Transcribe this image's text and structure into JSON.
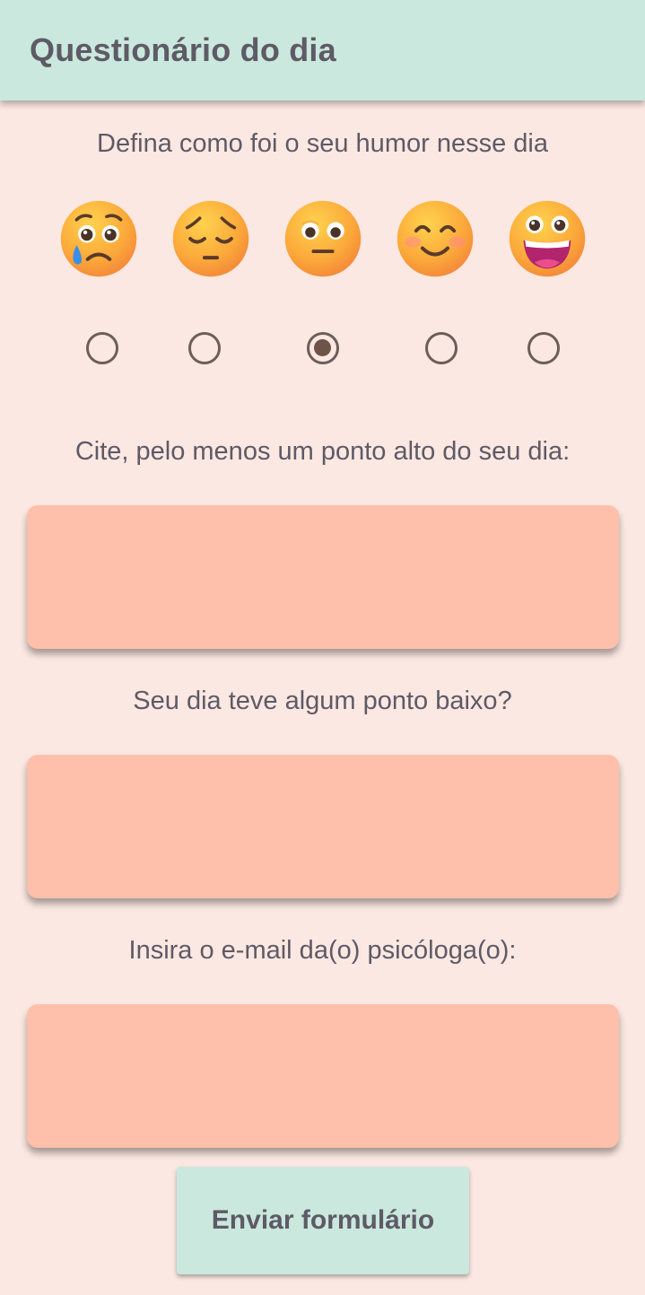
{
  "appbar": {
    "title": "Questionário do dia"
  },
  "mood": {
    "question": "Defina como foi o seu humor nesse dia",
    "options": [
      {
        "icon": "sad-tear-face-icon",
        "selected": false
      },
      {
        "icon": "pensive-face-icon",
        "selected": false
      },
      {
        "icon": "neutral-face-icon",
        "selected": true
      },
      {
        "icon": "smiling-blush-face-icon",
        "selected": false
      },
      {
        "icon": "grinning-face-icon",
        "selected": false
      }
    ]
  },
  "high_point": {
    "label": "Cite, pelo menos um ponto alto do seu dia:",
    "value": ""
  },
  "low_point": {
    "label": "Seu dia teve algum ponto baixo?",
    "value": ""
  },
  "email": {
    "label": "Insira o e-mail da(o) psicóloga(o):",
    "value": ""
  },
  "submit": {
    "label": "Enviar formulário"
  },
  "colors": {
    "appbar": "#cae8dd",
    "background": "#fce8e2",
    "field": "#fec0aa",
    "text": "#5e5a66",
    "radio": "#6b5e5a"
  }
}
